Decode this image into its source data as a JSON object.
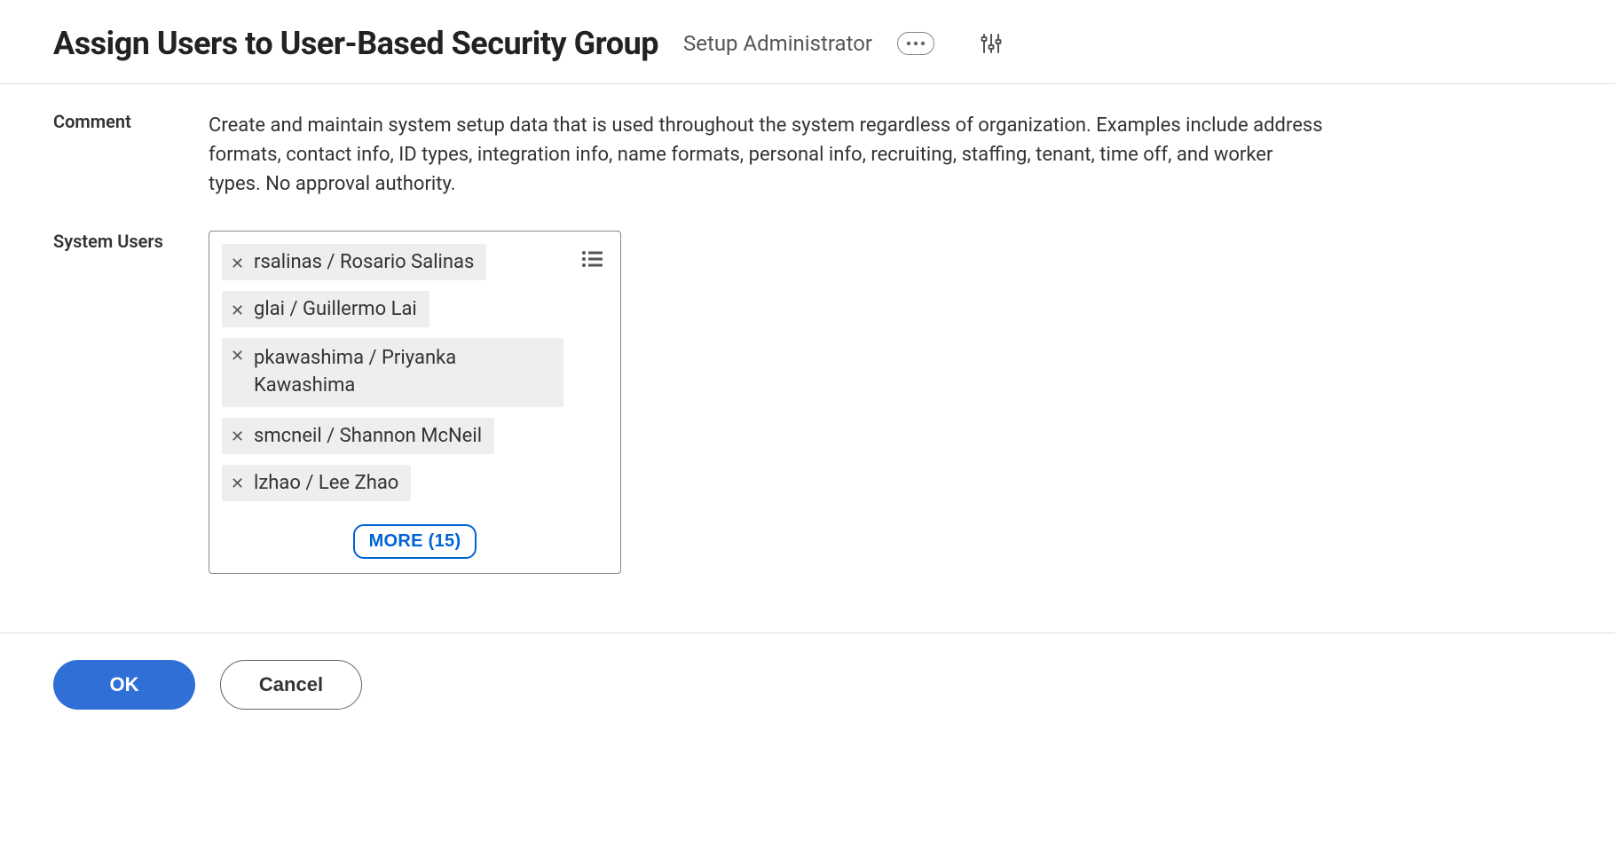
{
  "header": {
    "title": "Assign Users to User-Based Security Group",
    "subtitle": "Setup Administrator"
  },
  "form": {
    "comment_label": "Comment",
    "comment_text": "Create and maintain system setup data that is used throughout the system regardless of organization.  Examples include address formats, contact info, ID types, integration info, name formats, personal info, recruiting, staffing, tenant, time off, and worker types.  No approval authority.",
    "system_users_label": "System Users",
    "users": [
      "rsalinas / Rosario Salinas",
      "glai / Guillermo Lai",
      "pkawashima / Priyanka Kawashima",
      "smcneil / Shannon McNeil",
      "lzhao / Lee Zhao"
    ],
    "more_label": "MORE (15)"
  },
  "footer": {
    "ok_label": "OK",
    "cancel_label": "Cancel"
  }
}
